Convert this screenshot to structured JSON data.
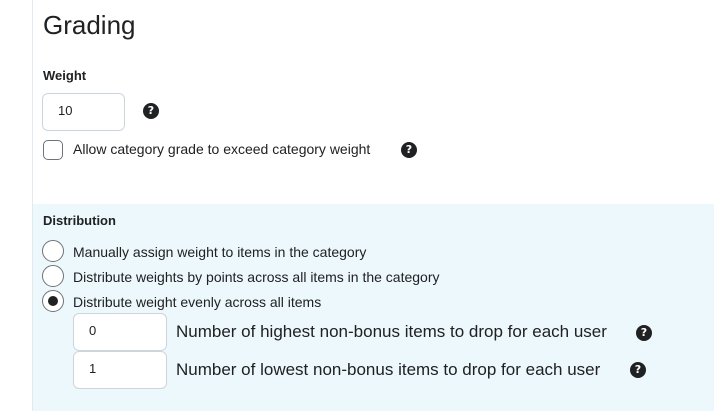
{
  "page": {
    "title": "Grading"
  },
  "weight": {
    "label": "Weight",
    "value": "10",
    "allow_exceed_label": "Allow category grade to exceed category weight",
    "allow_exceed_checked": false
  },
  "distribution": {
    "label": "Distribution",
    "options": [
      {
        "label": "Manually assign weight to items in the category",
        "selected": false
      },
      {
        "label": "Distribute weights by points across all items in the category",
        "selected": false
      },
      {
        "label": "Distribute weight evenly across all items",
        "selected": true
      }
    ],
    "drop_highest": {
      "value": "0",
      "label": "Number of highest non-bonus items to drop for each user"
    },
    "drop_lowest": {
      "value": "1",
      "label": "Number of lowest non-bonus items to drop for each user"
    }
  },
  "icons": {
    "help": "?"
  },
  "colors": {
    "panel_background": "#edf8fd",
    "text": "#202122",
    "border": "#cdd5dc"
  }
}
